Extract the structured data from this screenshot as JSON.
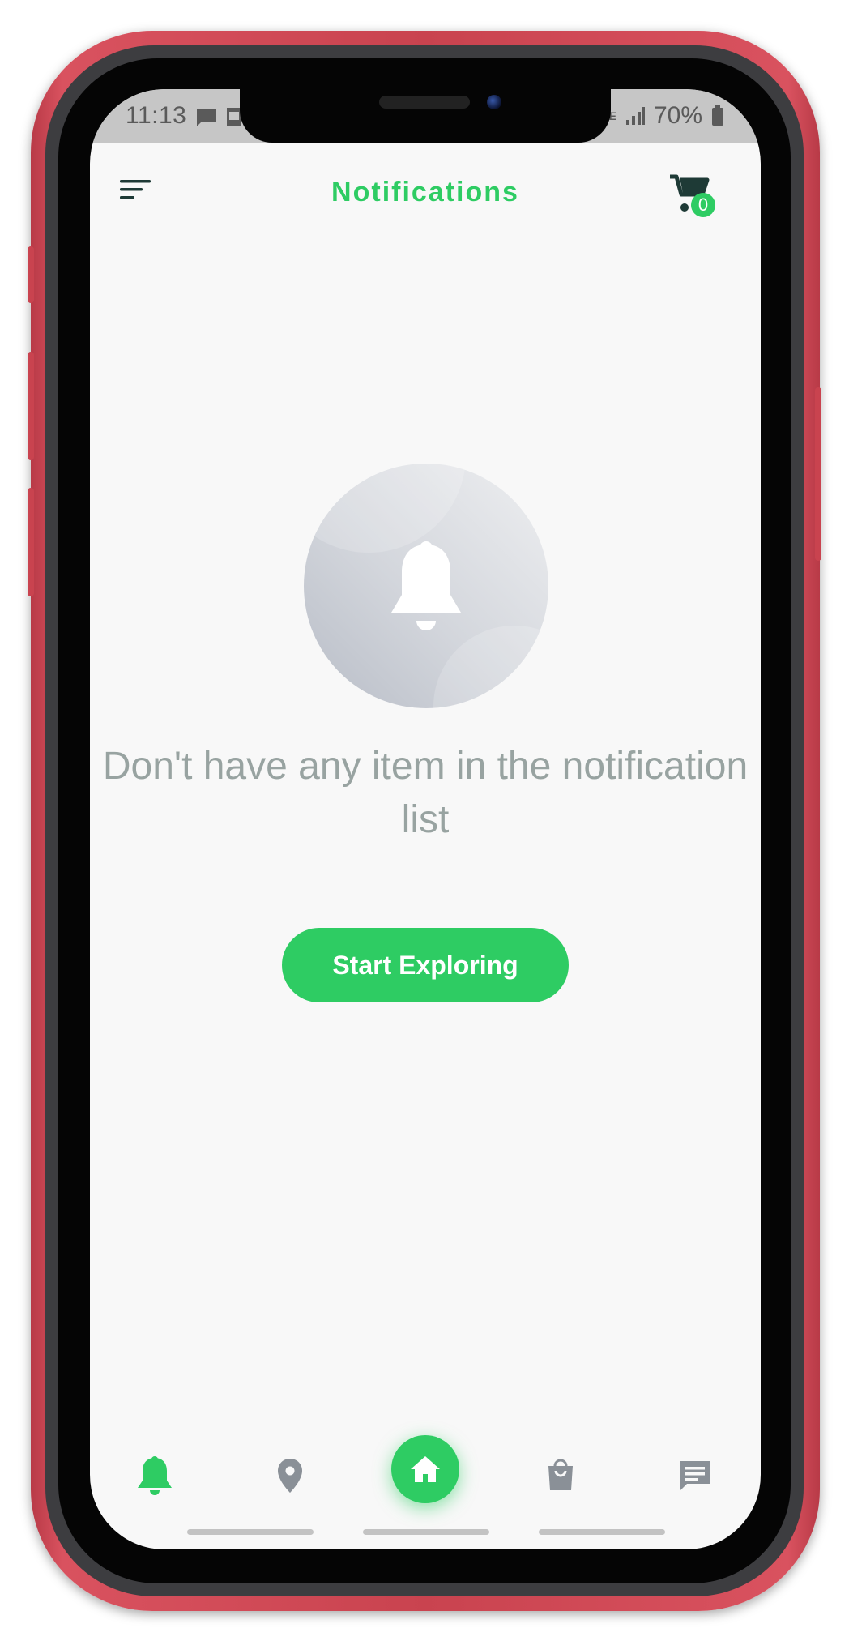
{
  "status_bar": {
    "time": "11:13",
    "network": "LTE",
    "battery": "70%",
    "icons": [
      "message-icon",
      "image-icon",
      "lte-icon",
      "signal-icon",
      "battery-icon"
    ]
  },
  "header": {
    "title": "Notifications",
    "menu_icon": "menu-icon",
    "cart_icon": "cart-icon",
    "cart_count": "0"
  },
  "empty_state": {
    "icon": "bell-icon",
    "message": "Don't have any item in the notification list",
    "cta_label": "Start Exploring"
  },
  "bottom_nav": {
    "items": [
      {
        "icon": "bell-icon",
        "active": true
      },
      {
        "icon": "location-icon",
        "active": false
      },
      {
        "icon": "home-icon",
        "active": true,
        "featured": true
      },
      {
        "icon": "shopping-bag-icon",
        "active": false
      },
      {
        "icon": "chat-icon",
        "active": false
      }
    ]
  },
  "colors": {
    "accent": "#2ecc63",
    "text_muted": "#98a3a1",
    "icon_inactive": "#8a9097",
    "dark_icon": "#1e3a36",
    "phone_frame": "#c9434f"
  }
}
